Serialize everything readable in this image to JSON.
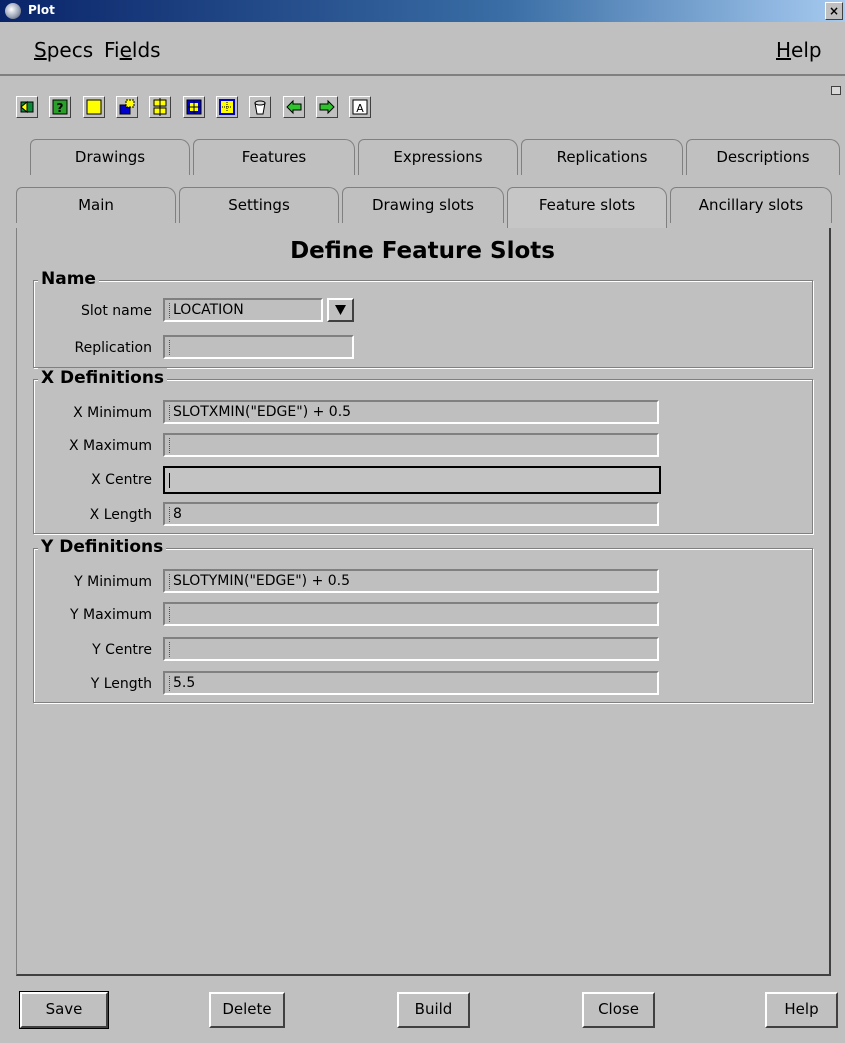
{
  "window": {
    "title": "Plot",
    "close_label": "×"
  },
  "menubar": {
    "specs": {
      "first": "S",
      "rest": "pecs"
    },
    "fields": {
      "first": "Fi",
      "u": "e",
      "rest": "lds"
    },
    "help": {
      "first": "H",
      "rest": "elp"
    }
  },
  "toolbar": {
    "icons": [
      "form-back-icon",
      "help-question-icon",
      "yellow-box-icon",
      "slot-icon",
      "align-icon",
      "move-icon",
      "grid-icon",
      "bucket-icon",
      "arrow-left-icon",
      "arrow-right-icon",
      "text-icon"
    ]
  },
  "tabs": {
    "row1": [
      "Drawings",
      "Features",
      "Expressions",
      "Replications",
      "Descriptions"
    ],
    "row2": [
      "Main",
      "Settings",
      "Drawing slots",
      "Feature slots",
      "Ancillary slots"
    ],
    "active": "Feature slots"
  },
  "page": {
    "heading": "Define Feature Slots"
  },
  "name_group": {
    "title": "Name",
    "slot_name_label": "Slot name",
    "slot_name_value": "LOCATION",
    "replication_label": "Replication",
    "replication_value": ""
  },
  "x_group": {
    "title": "X Definitions",
    "min_label": "X Minimum",
    "min_value": "SLOTXMIN(\"EDGE\") + 0.5",
    "max_label": "X Maximum",
    "max_value": "",
    "centre_label": "X Centre",
    "centre_value": "",
    "length_label": "X Length",
    "length_value": "8"
  },
  "y_group": {
    "title": "Y Definitions",
    "min_label": "Y Minimum",
    "min_value": "SLOTYMIN(\"EDGE\") + 0.5",
    "max_label": "Y Maximum",
    "max_value": "",
    "centre_label": "Y Centre",
    "centre_value": "",
    "length_label": "Y Length",
    "length_value": "5.5"
  },
  "buttons": {
    "save": "Save",
    "delete": "Delete",
    "build": "Build",
    "close": "Close",
    "help": "Help"
  }
}
